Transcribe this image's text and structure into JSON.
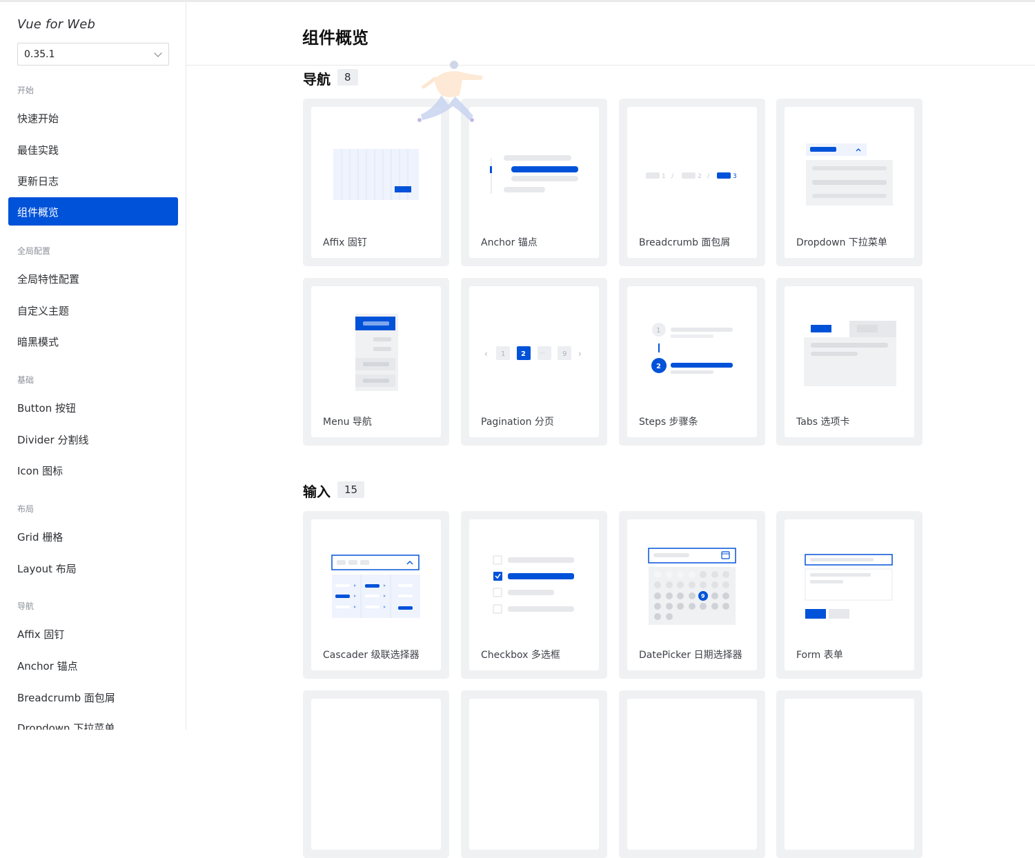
{
  "app": {
    "brand": "Vue for Web",
    "version": "0.35.1"
  },
  "sidebar": {
    "groups": [
      {
        "label": "开始",
        "items": [
          "快速开始",
          "最佳实践",
          "更新日志",
          "组件概览"
        ]
      },
      {
        "label": "全局配置",
        "items": [
          "全局特性配置",
          "自定义主题",
          "暗黑模式"
        ]
      },
      {
        "label": "基础",
        "items": [
          "Button 按钮",
          "Divider 分割线",
          "Icon 图标"
        ]
      },
      {
        "label": "布局",
        "items": [
          "Grid 栅格",
          "Layout 布局"
        ]
      },
      {
        "label": "导航",
        "items": [
          "Affix 固钉",
          "Anchor 锚点",
          "Breadcrumb 面包屑",
          "Dropdown 下拉菜单"
        ]
      }
    ],
    "active_item": "组件概览"
  },
  "page": {
    "title": "组件概览"
  },
  "sections": [
    {
      "title": "导航",
      "count": "8",
      "cards": [
        {
          "label": "Affix 固钉",
          "illus": "affix"
        },
        {
          "label": "Anchor 锚点",
          "illus": "anchor"
        },
        {
          "label": "Breadcrumb 面包屑",
          "illus": "breadcrumb"
        },
        {
          "label": "Dropdown 下拉菜单",
          "illus": "dropdown"
        },
        {
          "label": "Menu 导航",
          "illus": "menu"
        },
        {
          "label": "Pagination 分页",
          "illus": "pagination"
        },
        {
          "label": "Steps 步骤条",
          "illus": "steps"
        },
        {
          "label": "Tabs 选项卡",
          "illus": "tabs"
        }
      ]
    },
    {
      "title": "输入",
      "count": "15",
      "cards": [
        {
          "label": "Cascader 级联选择器",
          "illus": "cascader"
        },
        {
          "label": "Checkbox 多选框",
          "illus": "checkbox"
        },
        {
          "label": "DatePicker 日期选择器",
          "illus": "datepicker"
        },
        {
          "label": "Form 表单",
          "illus": "form"
        }
      ]
    }
  ],
  "illustration_text": {
    "breadcrumb": [
      "1",
      "2",
      "3"
    ],
    "pagination": [
      "‹",
      "1",
      "2",
      "···",
      "9",
      "›"
    ],
    "steps": [
      "1",
      "2"
    ],
    "datepicker_day": "9"
  },
  "colors": {
    "primary": "#0052d9",
    "light_gray": "#e7e8eb",
    "card_bg": "#f0f1f3"
  }
}
